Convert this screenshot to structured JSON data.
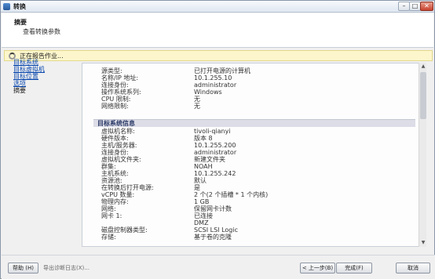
{
  "window": {
    "title": "转换"
  },
  "header": {
    "title": "摘要",
    "subtitle": "查看转换参数"
  },
  "status": {
    "text": "正在报告作业..."
  },
  "nav": [
    {
      "label": "目标系统",
      "link": true
    },
    {
      "label": "目标虚拟机",
      "link": true
    },
    {
      "label": "目标位置",
      "link": true
    },
    {
      "label": "选项",
      "link": true
    },
    {
      "label": "摘要",
      "link": false
    }
  ],
  "source": {
    "rows": [
      {
        "key": "源类型:",
        "value": "已打开电源的计算机"
      },
      {
        "key": "名称/IP 地址:",
        "value": "10.1.255.10"
      },
      {
        "key": "连接身份:",
        "value": "administrator"
      },
      {
        "key": "操作系统系列:",
        "value": "Windows"
      },
      {
        "key": "CPU 限制:",
        "value": "无"
      },
      {
        "key": "网络限制:",
        "value": "无"
      }
    ]
  },
  "target": {
    "heading": "目标系统信息",
    "rows": [
      {
        "key": "虚拟机名称:",
        "value": "tivoli-qianyi"
      },
      {
        "key": "硬件版本:",
        "value": "版本 8"
      },
      {
        "key": "主机/服务器:",
        "value": "10.1.255.200"
      },
      {
        "key": "连接身份:",
        "value": "administrator"
      },
      {
        "key": "虚拟机文件夹:",
        "value": "新建文件夹"
      },
      {
        "key": "群集:",
        "value": "NOAH"
      },
      {
        "key": "主机系统:",
        "value": "10.1.255.242"
      },
      {
        "key": "资源池:",
        "value": "默认"
      },
      {
        "key": "在转换后打开电源:",
        "value": "是"
      },
      {
        "key": "vCPU 数量:",
        "value": "2 个(2 个插槽 * 1 个内核)"
      },
      {
        "key": "物理内存:",
        "value": "1 GB"
      },
      {
        "key": "网络:",
        "value": "保留网卡计数"
      },
      {
        "key": "网卡 1:",
        "value": "已连接"
      },
      {
        "key": "",
        "value": "DMZ"
      },
      {
        "key": "磁盘控制器类型:",
        "value": "SCSI LSI Logic"
      },
      {
        "key": "存储:",
        "value": "基于卷的克隆"
      }
    ]
  },
  "footer": {
    "help": "帮助 (H)",
    "export": "导出诊断日志(X)...",
    "back": "< 上一步(B)",
    "next": "完成(F)",
    "cancel": "取消"
  }
}
